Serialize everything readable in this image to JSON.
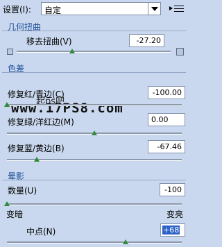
{
  "settings": {
    "label": "设置(I):",
    "value": "自定"
  },
  "geometry": {
    "title": "几何扭曲",
    "remove_distortion": {
      "label": "移去扭曲(V)",
      "value": "-27.20",
      "slider_fraction": 0.36
    }
  },
  "chromatic": {
    "title": "色差",
    "red_cyan": {
      "label": "修复红/青边(C)",
      "value": "-100.00",
      "slider_fraction": 0.0
    },
    "green_magenta": {
      "label": "修复绿/洋红边(M)",
      "value": "0.00",
      "slider_fraction": 0.5
    },
    "blue_yellow": {
      "label": "修复蓝/黄边(B)",
      "value": "-67.46",
      "slider_fraction": 0.17
    }
  },
  "vignette": {
    "title": "晕影",
    "amount": {
      "label": "数量(U)",
      "value": "-100",
      "slider_fraction": 0.0
    },
    "darken_label": "变暗",
    "lighten_label": "变亮",
    "midpoint": {
      "label": "中点(N)",
      "value": "+68",
      "slider_fraction": 0.68
    }
  },
  "watermark": {
    "line1": "起ps吧",
    "line2": "www.17PS8.com"
  },
  "colors": {
    "accent": "#1e4f9a",
    "panel": "#c9d8ee",
    "thumb": "#2f8a3a"
  },
  "icons": [
    "dropdown-arrow-icon",
    "panel-menu-icon",
    "grid-small-icon",
    "grid-large-icon",
    "slider-thumb-icon"
  ]
}
